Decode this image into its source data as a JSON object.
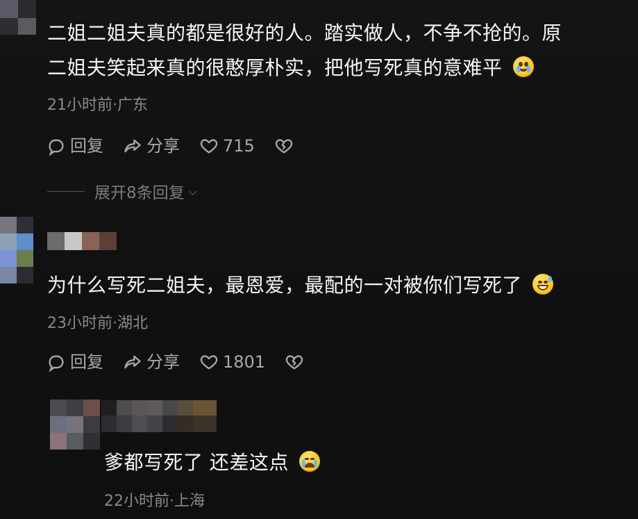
{
  "comments": [
    {
      "line1": "二姐二姐夫真的都是很好的人。踏实做人，不争不抢的。原",
      "line2": "二姐夫笑起来真的很憨厚朴实，把他写死真的意难平",
      "time": "21小时前·广东",
      "actions": {
        "reply": "回复",
        "share": "分享",
        "likes": "715"
      },
      "expand": "展开8条回复"
    },
    {
      "line1": "为什么写死二姐夫，最恩爱，最配的一对被你们写死了",
      "time": "23小时前·湖北",
      "actions": {
        "reply": "回复",
        "share": "分享",
        "likes": "1801"
      }
    },
    {
      "line1": "爹都写死了  还差这点",
      "time": "22小时前·上海"
    }
  ],
  "colors": {
    "background": "#111111",
    "text": "#f5f5f5",
    "meta": "#8a8a8a",
    "action": "#a9a9a9"
  },
  "icons": [
    "chat-bubble-icon",
    "share-arrow-icon",
    "heart-outline-icon",
    "heart-broken-icon",
    "chevron-down-icon",
    "pleading-face-icon",
    "grinning-sweat-icon",
    "crying-face-icon"
  ]
}
